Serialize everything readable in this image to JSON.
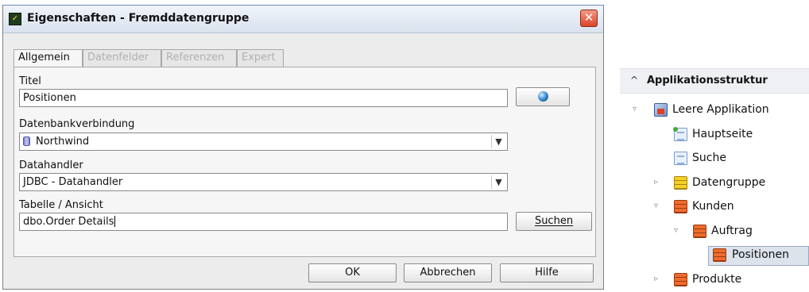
{
  "dialog": {
    "title": "Eigenschaften - Fremddatengruppe",
    "close_symbol": "✕",
    "tabs": [
      {
        "label": "Allgemein",
        "active": true
      },
      {
        "label": "Datenfelder",
        "active": false
      },
      {
        "label": "Referenzen",
        "active": false
      },
      {
        "label": "Expert",
        "active": false
      }
    ],
    "fields": {
      "titel_label": "Titel",
      "titel_value": "Positionen",
      "datenbank_label": "Datenbankverbindung",
      "datenbank_value": "Northwind",
      "datahandler_label": "Datahandler",
      "datahandler_value": "JDBC - Datahandler",
      "tabelle_label": "Tabelle / Ansicht",
      "tabelle_value": "dbo.Order Details"
    },
    "buttons": {
      "suchen": "Suchen",
      "ok": "OK",
      "abbrechen": "Abbrechen",
      "hilfe": "Hilfe"
    },
    "icons": {
      "app": "window-app-icon",
      "globe": "globe-icon",
      "database": "database-icon",
      "combo_arrow": "chevron-down-icon"
    }
  },
  "tree": {
    "header": "Applikationsstruktur",
    "header_arrow": "^",
    "nodes": [
      {
        "label": "Leere Applikation",
        "icon": "application-icon",
        "toggle": "▿"
      },
      {
        "label": "Hauptseite",
        "icon": "home-page-icon",
        "toggle": ""
      },
      {
        "label": "Suche",
        "icon": "page-icon",
        "toggle": ""
      },
      {
        "label": "Datengruppe",
        "icon": "datagroup-yellow-icon",
        "toggle": "▹"
      },
      {
        "label": "Kunden",
        "icon": "datagroup-orange-icon",
        "toggle": "▿"
      },
      {
        "label": "Auftrag",
        "icon": "datagroup-orange-icon",
        "toggle": "▿"
      },
      {
        "label": "Positionen",
        "icon": "datagroup-orange-icon",
        "toggle": "",
        "selected": true
      },
      {
        "label": "Produkte",
        "icon": "datagroup-orange-icon",
        "toggle": "▹"
      }
    ]
  }
}
